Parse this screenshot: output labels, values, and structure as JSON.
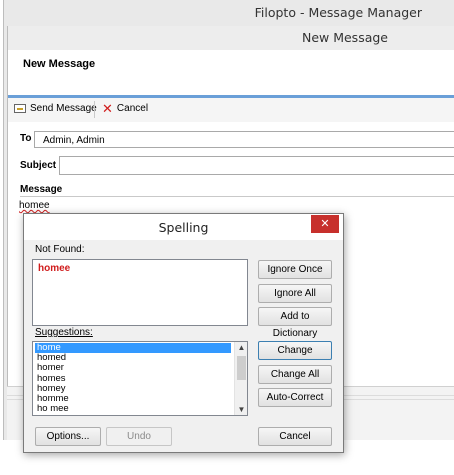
{
  "outer_window": {
    "title": "Filopto - Message Manager"
  },
  "inner_window": {
    "title": "New Message"
  },
  "page": {
    "heading": "New Message"
  },
  "toolbar": {
    "send_label": "Send Message",
    "cancel_label": "Cancel"
  },
  "form": {
    "to_label": "To",
    "to_value": "Admin, Admin",
    "subject_label": "Subject",
    "subject_value": "",
    "message_label": "Message",
    "message_value": "homee"
  },
  "spelling_dialog": {
    "title": "Spelling",
    "close_glyph": "✕",
    "not_found_label": "Not Found:",
    "not_found_word": "homee",
    "suggestions_label": "Suggestions:",
    "suggestions": [
      "home",
      "homed",
      "homer",
      "homes",
      "homey",
      "homme",
      "ho mee"
    ],
    "selected_suggestion": "home",
    "buttons": {
      "ignore_once": "Ignore Once",
      "ignore_all": "Ignore All",
      "add_to_dictionary": "Add to Dictionary",
      "change": "Change",
      "change_all": "Change All",
      "auto_correct": "Auto-Correct",
      "options": "Options...",
      "undo": "Undo",
      "cancel": "Cancel"
    }
  },
  "colors": {
    "accent_rule": "#6a9fd8",
    "close_button": "#c7302c",
    "error_word": "#d01c1c",
    "selection": "#3399ff"
  },
  "icons": {
    "send": "envelope-icon",
    "cancel": "red-x-icon",
    "close": "close-icon"
  }
}
